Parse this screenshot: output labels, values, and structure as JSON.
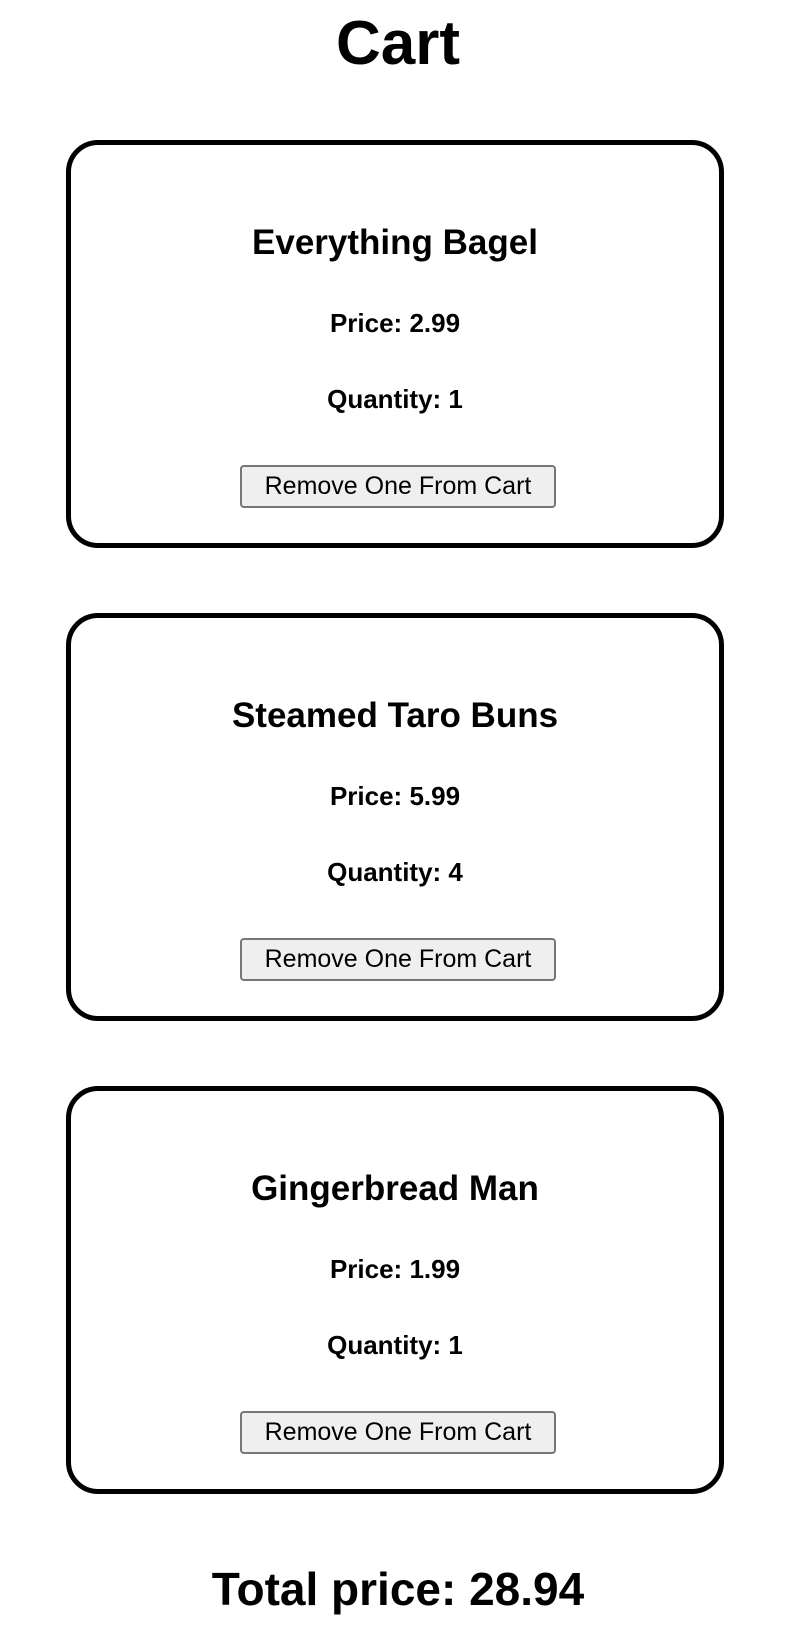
{
  "page": {
    "title": "Cart"
  },
  "cart": {
    "items": [
      {
        "name": "Everything Bagel",
        "price_text": "Price: 2.99",
        "quantity_text": "Quantity: 1",
        "remove_label": "Remove One From Cart"
      },
      {
        "name": "Steamed Taro Buns",
        "price_text": "Price: 5.99",
        "quantity_text": "Quantity: 4",
        "remove_label": "Remove One From Cart"
      },
      {
        "name": "Gingerbread Man",
        "price_text": "Price: 1.99",
        "quantity_text": "Quantity: 1",
        "remove_label": "Remove One From Cart"
      }
    ],
    "total_text": "Total price: 28.94"
  }
}
